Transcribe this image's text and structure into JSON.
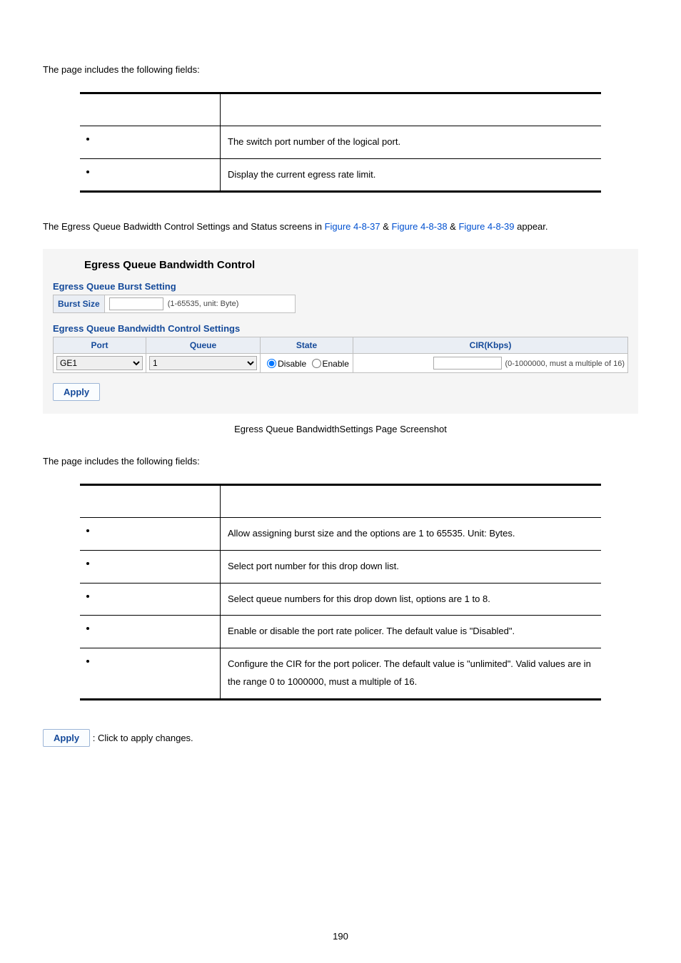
{
  "intro1": "The page includes the following fields:",
  "table1": {
    "rows": [
      {
        "desc": "The switch port number of the logical port."
      },
      {
        "desc": "Display the current egress rate limit."
      }
    ]
  },
  "para2_pre": "The Egress Queue Badwidth Control Settings and Status screens in ",
  "para2_links": [
    "Figure 4-8-37",
    "Figure 4-8-38",
    "Figure 4-8-39"
  ],
  "para2_amp": " & ",
  "para2_post": " appear.",
  "shot": {
    "title": "Egress Queue Bandwidth Control",
    "burst_section": "Egress Queue Burst Setting",
    "burst_label": "Burst Size",
    "burst_hint": "(1-65535, unit: Byte)",
    "ctrl_section": "Egress Queue Bandwidth Control Settings",
    "headers": {
      "port": "Port",
      "queue": "Queue",
      "state": "State",
      "cir": "CIR(Kbps)"
    },
    "port_value": "GE1",
    "queue_value": "1",
    "state_disable": "Disable",
    "state_enable": "Enable",
    "cir_hint": "(0-1000000, must a multiple of 16)",
    "apply": "Apply"
  },
  "caption": "Egress Queue BandwidthSettings Page Screenshot",
  "intro2": "The page includes the following fields:",
  "table2": {
    "rows": [
      {
        "desc": "Allow assigning burst size and the options are 1 to 65535. Unit: Bytes."
      },
      {
        "desc": "Select port number for this drop down list."
      },
      {
        "desc": "Select queue numbers for this drop down list, options are 1 to 8."
      },
      {
        "desc": "Enable or disable the port rate policer. The default value is \"Disabled\"."
      },
      {
        "desc": "Configure the CIR for the port policer. The default value is \"unlimited\". Valid values are in the range 0 to 1000000, must a multiple of 16."
      }
    ]
  },
  "apply_inline": "Apply",
  "apply_inline_text": ": Click to apply changes.",
  "page_number": "190"
}
